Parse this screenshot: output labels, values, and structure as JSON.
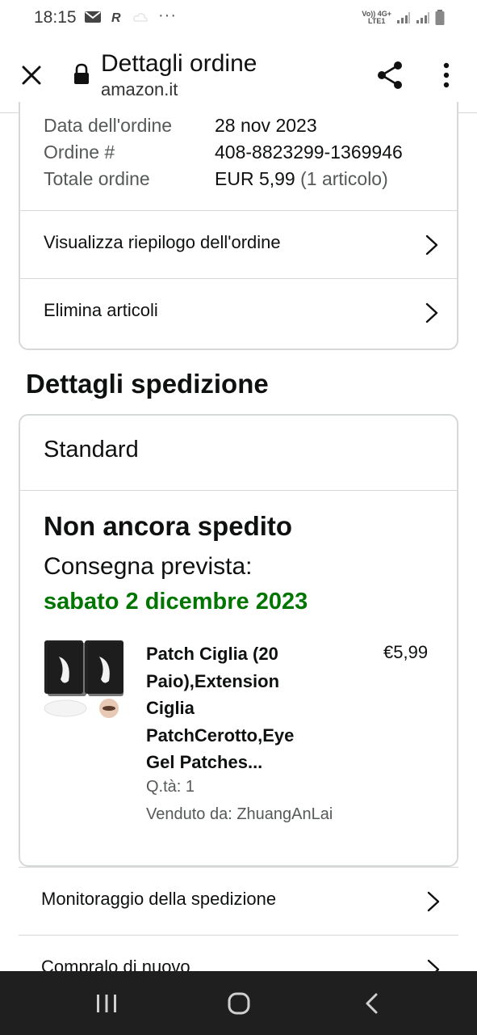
{
  "status_bar": {
    "time": "18:15",
    "dots": "···",
    "network_top": "Vo)) 4G+",
    "network_bottom": "LTE1"
  },
  "header": {
    "title": "Dettagli ordine",
    "url": "amazon.it"
  },
  "order_summary": {
    "rows": [
      {
        "label": "Data dell'ordine",
        "value": "28 nov 2023"
      },
      {
        "label": "Ordine #",
        "value": "408-8823299-1369946"
      },
      {
        "label": "Totale ordine",
        "value": "EUR 5,99",
        "value_extra": "(1 articolo)"
      }
    ],
    "links": [
      {
        "label": "Visualizza riepilogo dell'ordine"
      },
      {
        "label": "Elimina articoli"
      }
    ]
  },
  "shipment": {
    "section_title": "Dettagli spedizione",
    "method": "Standard",
    "status": "Non ancora spedito",
    "eta_label": "Consegna prevista:",
    "eta_date": "sabato 2 dicembre 2023",
    "eta_color": "#007600",
    "item": {
      "title": "Patch Ciglia (20 Paio),Extension Ciglia PatchCerotto,Eye Gel Patches...",
      "price": "€5,99",
      "quantity": "Q.tà: 1",
      "seller": "Venduto da: ZhuangAnLai"
    }
  },
  "actions": [
    {
      "label": "Monitoraggio della spedizione"
    },
    {
      "label": "Compralo di nuovo"
    }
  ],
  "icons": {
    "close": "close-icon",
    "lock": "lock-icon",
    "share": "share-icon",
    "menu": "more-vertical-icon",
    "chevron": "chevron-right-icon",
    "nav_recent": "recent-apps-icon",
    "nav_home": "home-icon",
    "nav_back": "back-icon"
  }
}
